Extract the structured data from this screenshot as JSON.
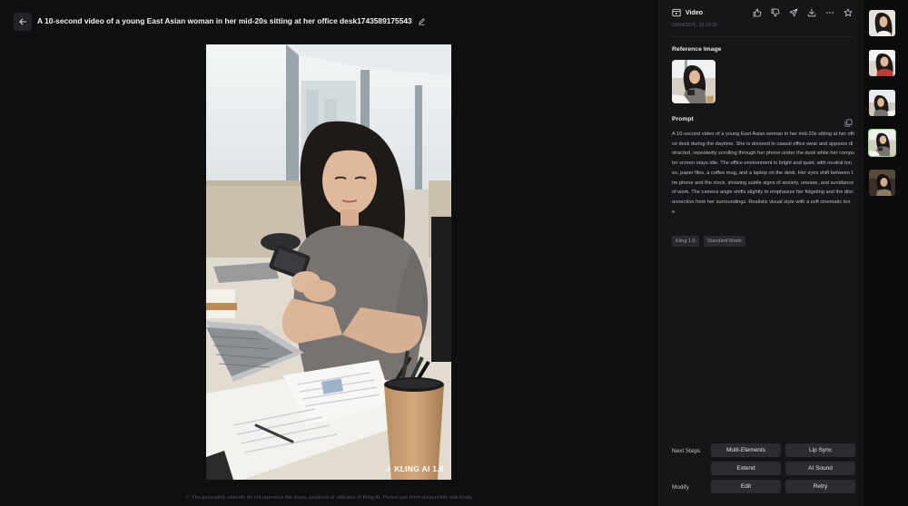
{
  "header": {
    "title": "A 10-second video of a young East Asian woman in her mid-20s sitting at her office desk1743589175543"
  },
  "video": {
    "watermark": "KLING AI 1.6"
  },
  "disclaimer": "ⓘ The generated contents do not represent the views, positions or attitudes of Kling AI. Please use them responsibly and kindly.",
  "panel": {
    "type_label": "Video",
    "date": "02/04/2025, 18:19:35",
    "reference_image_label": "Reference Image",
    "prompt_label": "Prompt",
    "prompt_text": "A 10-second video of a young East Asian woman in her mid-20s sitting at her office desk during the daytime. She is dressed in casual office wear and appears distracted, repeatedly scrolling through her phone under the desk while her computer screen stays idle. The office environment is bright and quiet, with neutral tones, paper files, a coffee mug, and a laptop on the desk. Her eyes shift between the phone and the clock, showing subtle signs of anxiety, unease, and avoidance of work. The camera angle shifts slightly to emphasize her fidgeting and the disconnection from her surroundings. Realistic visual style with a soft cinematic tone.",
    "tags": [
      "Kling 1.6",
      "Standard Mode"
    ],
    "next_steps_label": "Next Steps",
    "modify_label": "Modify",
    "buttons": {
      "multi_elements": "Multi-Elements",
      "lip_sync": "Lip Sync",
      "extend": "Extend",
      "ai_sound": "AI Sound",
      "edit": "Edit",
      "retry": "Retry"
    }
  },
  "icons": {
    "back": "arrow-left-icon",
    "edit": "pencil-icon",
    "video": "video-icon",
    "like": "thumbs-up-icon",
    "dislike": "thumbs-down-icon",
    "share": "send-icon",
    "download": "download-icon",
    "more": "more-icon",
    "favorite": "star-icon",
    "copy": "copy-icon"
  },
  "colors": {
    "active_thumb_border": "#8fe07a",
    "panel_bg": "#161618",
    "button_bg": "#2c2c30"
  }
}
